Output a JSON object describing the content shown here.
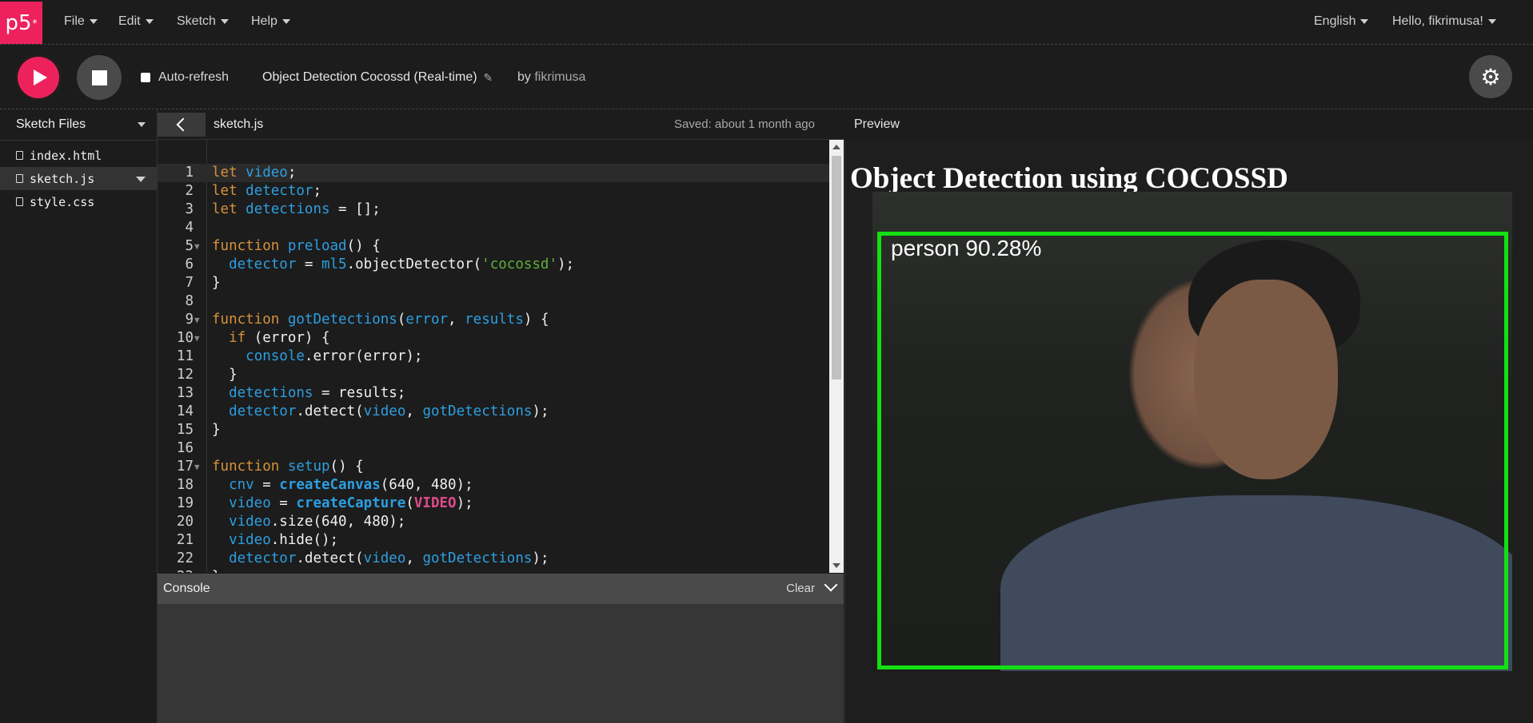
{
  "nav": {
    "logo": "p5",
    "logo_sup": "*",
    "menus": [
      "File",
      "Edit",
      "Sketch",
      "Help"
    ],
    "language": "English",
    "user": "Hello, fikrimusa!"
  },
  "toolbar": {
    "auto_refresh_label": "Auto-refresh",
    "sketch_title": "Object Detection Cocossd (Real-time)",
    "by_label": "by",
    "author": "fikrimusa"
  },
  "sidebar": {
    "header": "Sketch Files",
    "files": [
      "index.html",
      "sketch.js",
      "style.css"
    ],
    "active_file": "sketch.js"
  },
  "editor": {
    "tab_name": "sketch.js",
    "saved_status": "Saved: about 1 month ago"
  },
  "console": {
    "title": "Console",
    "clear_label": "Clear"
  },
  "preview": {
    "header": "Preview",
    "title": "Object Detection using COCOSSD",
    "detection_label": "person 90.28%"
  },
  "colors": {
    "accent": "#ed225d",
    "keyword": "#d6923b",
    "variable": "#2d9ee0",
    "string": "#5fae3a",
    "builtin_fn": "#2d9ee0",
    "constant": "#de4a8c",
    "bbox": "#12e012"
  }
}
